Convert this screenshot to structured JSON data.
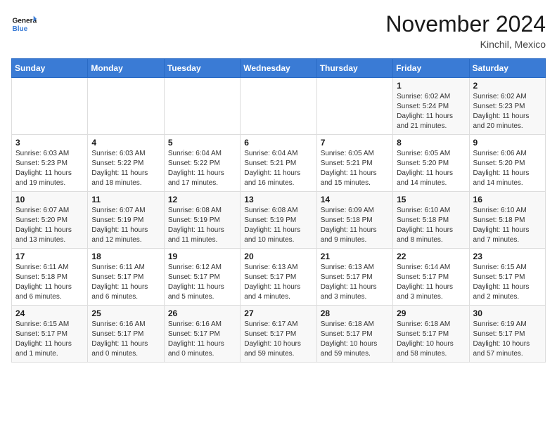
{
  "logo": {
    "line1": "General",
    "line2": "Blue"
  },
  "title": "November 2024",
  "location": "Kinchil, Mexico",
  "days_header": [
    "Sunday",
    "Monday",
    "Tuesday",
    "Wednesday",
    "Thursday",
    "Friday",
    "Saturday"
  ],
  "weeks": [
    [
      {
        "num": "",
        "info": ""
      },
      {
        "num": "",
        "info": ""
      },
      {
        "num": "",
        "info": ""
      },
      {
        "num": "",
        "info": ""
      },
      {
        "num": "",
        "info": ""
      },
      {
        "num": "1",
        "info": "Sunrise: 6:02 AM\nSunset: 5:24 PM\nDaylight: 11 hours and 21 minutes."
      },
      {
        "num": "2",
        "info": "Sunrise: 6:02 AM\nSunset: 5:23 PM\nDaylight: 11 hours and 20 minutes."
      }
    ],
    [
      {
        "num": "3",
        "info": "Sunrise: 6:03 AM\nSunset: 5:23 PM\nDaylight: 11 hours and 19 minutes."
      },
      {
        "num": "4",
        "info": "Sunrise: 6:03 AM\nSunset: 5:22 PM\nDaylight: 11 hours and 18 minutes."
      },
      {
        "num": "5",
        "info": "Sunrise: 6:04 AM\nSunset: 5:22 PM\nDaylight: 11 hours and 17 minutes."
      },
      {
        "num": "6",
        "info": "Sunrise: 6:04 AM\nSunset: 5:21 PM\nDaylight: 11 hours and 16 minutes."
      },
      {
        "num": "7",
        "info": "Sunrise: 6:05 AM\nSunset: 5:21 PM\nDaylight: 11 hours and 15 minutes."
      },
      {
        "num": "8",
        "info": "Sunrise: 6:05 AM\nSunset: 5:20 PM\nDaylight: 11 hours and 14 minutes."
      },
      {
        "num": "9",
        "info": "Sunrise: 6:06 AM\nSunset: 5:20 PM\nDaylight: 11 hours and 14 minutes."
      }
    ],
    [
      {
        "num": "10",
        "info": "Sunrise: 6:07 AM\nSunset: 5:20 PM\nDaylight: 11 hours and 13 minutes."
      },
      {
        "num": "11",
        "info": "Sunrise: 6:07 AM\nSunset: 5:19 PM\nDaylight: 11 hours and 12 minutes."
      },
      {
        "num": "12",
        "info": "Sunrise: 6:08 AM\nSunset: 5:19 PM\nDaylight: 11 hours and 11 minutes."
      },
      {
        "num": "13",
        "info": "Sunrise: 6:08 AM\nSunset: 5:19 PM\nDaylight: 11 hours and 10 minutes."
      },
      {
        "num": "14",
        "info": "Sunrise: 6:09 AM\nSunset: 5:18 PM\nDaylight: 11 hours and 9 minutes."
      },
      {
        "num": "15",
        "info": "Sunrise: 6:10 AM\nSunset: 5:18 PM\nDaylight: 11 hours and 8 minutes."
      },
      {
        "num": "16",
        "info": "Sunrise: 6:10 AM\nSunset: 5:18 PM\nDaylight: 11 hours and 7 minutes."
      }
    ],
    [
      {
        "num": "17",
        "info": "Sunrise: 6:11 AM\nSunset: 5:18 PM\nDaylight: 11 hours and 6 minutes."
      },
      {
        "num": "18",
        "info": "Sunrise: 6:11 AM\nSunset: 5:17 PM\nDaylight: 11 hours and 6 minutes."
      },
      {
        "num": "19",
        "info": "Sunrise: 6:12 AM\nSunset: 5:17 PM\nDaylight: 11 hours and 5 minutes."
      },
      {
        "num": "20",
        "info": "Sunrise: 6:13 AM\nSunset: 5:17 PM\nDaylight: 11 hours and 4 minutes."
      },
      {
        "num": "21",
        "info": "Sunrise: 6:13 AM\nSunset: 5:17 PM\nDaylight: 11 hours and 3 minutes."
      },
      {
        "num": "22",
        "info": "Sunrise: 6:14 AM\nSunset: 5:17 PM\nDaylight: 11 hours and 3 minutes."
      },
      {
        "num": "23",
        "info": "Sunrise: 6:15 AM\nSunset: 5:17 PM\nDaylight: 11 hours and 2 minutes."
      }
    ],
    [
      {
        "num": "24",
        "info": "Sunrise: 6:15 AM\nSunset: 5:17 PM\nDaylight: 11 hours and 1 minute."
      },
      {
        "num": "25",
        "info": "Sunrise: 6:16 AM\nSunset: 5:17 PM\nDaylight: 11 hours and 0 minutes."
      },
      {
        "num": "26",
        "info": "Sunrise: 6:16 AM\nSunset: 5:17 PM\nDaylight: 11 hours and 0 minutes."
      },
      {
        "num": "27",
        "info": "Sunrise: 6:17 AM\nSunset: 5:17 PM\nDaylight: 10 hours and 59 minutes."
      },
      {
        "num": "28",
        "info": "Sunrise: 6:18 AM\nSunset: 5:17 PM\nDaylight: 10 hours and 59 minutes."
      },
      {
        "num": "29",
        "info": "Sunrise: 6:18 AM\nSunset: 5:17 PM\nDaylight: 10 hours and 58 minutes."
      },
      {
        "num": "30",
        "info": "Sunrise: 6:19 AM\nSunset: 5:17 PM\nDaylight: 10 hours and 57 minutes."
      }
    ]
  ]
}
